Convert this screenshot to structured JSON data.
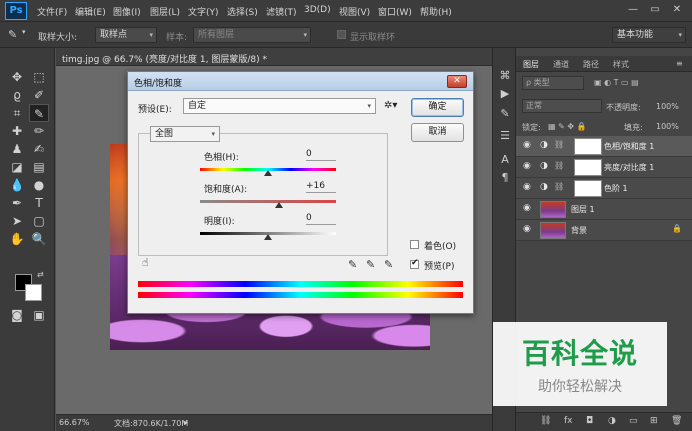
{
  "app": {
    "logo": "Ps"
  },
  "menu": [
    "文件(F)",
    "编辑(E)",
    "图像(I)",
    "图层(L)",
    "文字(Y)",
    "选择(S)",
    "滤镜(T)",
    "3D(D)",
    "视图(V)",
    "窗口(W)",
    "帮助(H)"
  ],
  "window_controls": {
    "minimize": "—",
    "restore": "▭",
    "close": "✕"
  },
  "options": {
    "sample_size_label": "取样大小:",
    "sample_size_value": "取样点",
    "sample_label": "样本:",
    "sample_value": "所有图层",
    "show_ring_label": "显示取样环",
    "workspace": "基本功能"
  },
  "document": {
    "tab": "timg.jpg @ 66.7% (亮度/对比度 1, 图层蒙版/8) *",
    "zoom": "66.67%",
    "doc_size": "文档:870.6K/1.70M"
  },
  "dialog": {
    "title": "色相/饱和度",
    "preset_label": "预设(E):",
    "preset_value": "自定",
    "range_value": "全图",
    "hue_label": "色相(H):",
    "hue_value": "0",
    "saturation_label": "饱和度(A):",
    "saturation_value": "+16",
    "lightness_label": "明度(I):",
    "lightness_value": "0",
    "ok": "确定",
    "cancel": "取消",
    "colorize_label": "着色(O)",
    "colorize_checked": false,
    "preview_label": "预览(P)",
    "preview_checked": true,
    "slider_positions": {
      "hue": 0.5,
      "saturation": 0.58,
      "lightness": 0.5
    }
  },
  "layers_panel": {
    "tabs": [
      "图层",
      "通道",
      "路径",
      "样式"
    ],
    "filter_label": "类型",
    "blend_mode": "正常",
    "opacity_label": "不透明度:",
    "opacity_value": "100%",
    "lock_label": "锁定:",
    "fill_label": "填充:",
    "fill_value": "100%",
    "layers": [
      {
        "name": "色相/饱和度 1",
        "kind": "adjustment",
        "selected": true
      },
      {
        "name": "亮度/对比度 1",
        "kind": "adjustment",
        "selected": false
      },
      {
        "name": "色阶 1",
        "kind": "adjustment",
        "selected": false
      },
      {
        "name": "图层 1",
        "kind": "image",
        "selected": false
      },
      {
        "name": "背景",
        "kind": "background",
        "selected": false
      }
    ]
  },
  "watermark": {
    "title": "百科全说",
    "subtitle": "助你轻松解决"
  }
}
